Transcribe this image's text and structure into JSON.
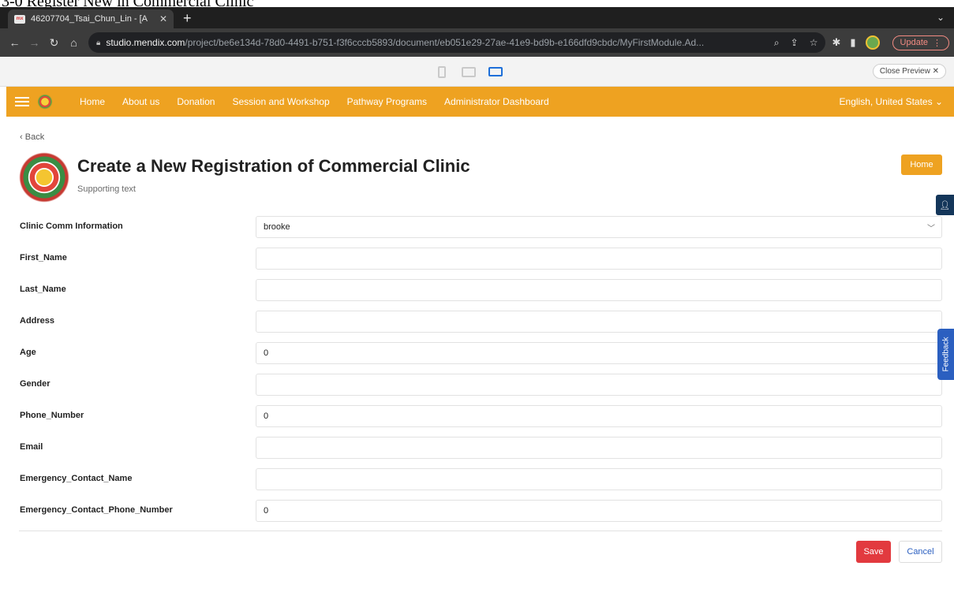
{
  "caption": "3-0 Register New in Commercial Clinic",
  "browser": {
    "tab_title": "46207704_Tsai_Chun_Lin - [A",
    "tab_favicon_text": "mx",
    "url_host": "studio.mendix.com",
    "url_path": "/project/be6e134d-78d0-4491-b751-f3f6cccb5893/document/eb051e29-27ae-41e9-bd9b-e166dfd9cbdc/MyFirstModule.Ad...",
    "update_label": "Update"
  },
  "preview": {
    "close_label": "Close Preview",
    "devices": [
      "phone",
      "tablet",
      "desktop"
    ],
    "active_device": "desktop"
  },
  "nav": {
    "links": [
      "Home",
      "About us",
      "Donation",
      "Session and Workshop",
      "Pathway Programs",
      "Administrator Dashboard"
    ],
    "language": "English, United States"
  },
  "page": {
    "back_label": "Back",
    "title": "Create a New Registration of Commercial Clinic",
    "supporting_text": "Supporting text",
    "home_button": "Home"
  },
  "form": {
    "fields": [
      {
        "label": "Clinic Comm Information",
        "value": "brooke",
        "type": "select"
      },
      {
        "label": "First_Name",
        "value": ""
      },
      {
        "label": "Last_Name",
        "value": ""
      },
      {
        "label": "Address",
        "value": ""
      },
      {
        "label": "Age",
        "value": "0"
      },
      {
        "label": "Gender",
        "value": ""
      },
      {
        "label": "Phone_Number",
        "value": "0"
      },
      {
        "label": "Email",
        "value": ""
      },
      {
        "label": "Emergency_Contact_Name",
        "value": ""
      },
      {
        "label": "Emergency_Contact_Phone_Number",
        "value": "0"
      }
    ],
    "save_label": "Save",
    "cancel_label": "Cancel"
  },
  "side": {
    "feedback_label": "Feedback"
  },
  "colors": {
    "brand": "#eea221",
    "save": "#e23a3f",
    "feedback": "#2b5fc0"
  }
}
